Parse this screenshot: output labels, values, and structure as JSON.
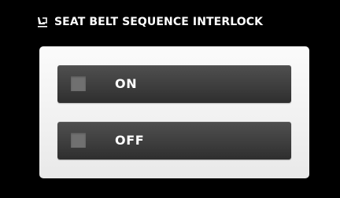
{
  "header": {
    "icon": "seat-belt-icon",
    "title": "SEAT BELT SEQUENCE INTERLOCK"
  },
  "options": [
    {
      "label": "ON",
      "checked": false
    },
    {
      "label": "OFF",
      "checked": false
    }
  ]
}
